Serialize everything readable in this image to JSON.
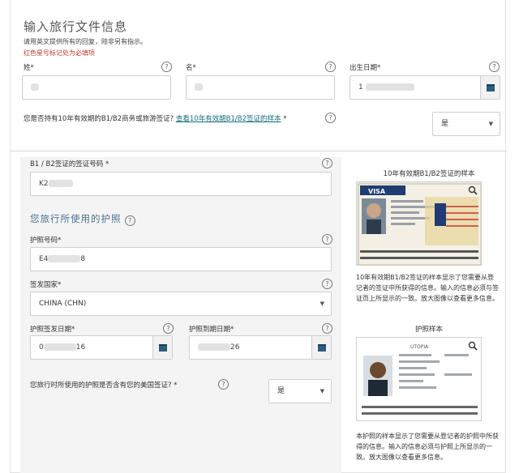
{
  "header": {
    "title": "输入旅行文件信息",
    "note": "请用英文提供所有的回复，除非另有指示。",
    "required_note": "红色星号标记处为必填项"
  },
  "fields": {
    "surname": {
      "label": "姓",
      "req": "*"
    },
    "given_name": {
      "label": "名",
      "req": "*"
    },
    "birth_date": {
      "label": "出生日期",
      "req": "*",
      "value_start": "1"
    },
    "visa_question": {
      "text": "您是否持有10年有效期的B1/B2商务或旅游签证?",
      "link": "查看10年有效期B1/B2签证的样本",
      "req": "*",
      "answer": "是"
    },
    "visa_number": {
      "label": "B1 / B2签证的签证号码",
      "req": "*",
      "value_start": "K2"
    },
    "passport_section_title": "您旅行所使用的护照",
    "passport_number": {
      "label": "护照号码",
      "req": "*",
      "value_start": "E4",
      "value_end": "8"
    },
    "issuing_country": {
      "label": "签发国家",
      "req": "*",
      "value": "CHINA (CHN)"
    },
    "issue_date": {
      "label": "护照签发日期",
      "req": "*",
      "value_start": "0",
      "value_end": "16"
    },
    "expiry_date": {
      "label": "护照到期日期",
      "req": "*",
      "value_end": "26"
    },
    "us_visa_question": {
      "text": "您旅行时所使用的护照是否含有您的美国签证?",
      "req": "*",
      "answer": "是"
    }
  },
  "samples": {
    "visa_title": "10年有效期B1/B2签证的样本",
    "visa_card_label": "VISA",
    "visa_caption": "10年有效期B1/B2签证的样本显示了您需要从登记者的签证中所获得的信息。输入的信息必须与签证页上所显示的一致。放大图像以查看更多信息。",
    "passport_title": "护照样本",
    "passport_card_label": "UTOPIA",
    "passport_caption": "本护照的样本显示了您需要从登记者的护照中所获得的信息。输入的信息必须与护照上所显示的一致。放大图像以查看更多信息。"
  },
  "icons": {
    "help": "?",
    "calendar": "calendar-icon",
    "caret": "▼",
    "zoom": "magnifier-icon"
  },
  "colors": {
    "required": "#c0392b",
    "link": "#1a6e82",
    "accent": "#2c5d7c"
  }
}
